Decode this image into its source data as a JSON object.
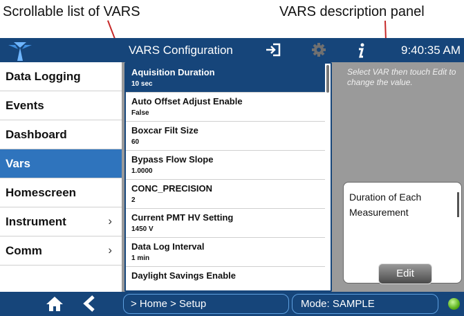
{
  "callouts": {
    "list": "Scrollable list of VARS",
    "description": "VARS description panel"
  },
  "header": {
    "title": "VARS Configuration",
    "time": "9:40:35 AM"
  },
  "sidebar": {
    "items": [
      {
        "label": "Data Logging",
        "chevron": false,
        "selected": false
      },
      {
        "label": "Events",
        "chevron": false,
        "selected": false
      },
      {
        "label": "Dashboard",
        "chevron": false,
        "selected": false
      },
      {
        "label": "Vars",
        "chevron": false,
        "selected": true
      },
      {
        "label": "Homescreen",
        "chevron": false,
        "selected": false
      },
      {
        "label": "Instrument",
        "chevron": true,
        "selected": false
      },
      {
        "label": "Comm",
        "chevron": true,
        "selected": false
      }
    ]
  },
  "vars": [
    {
      "name": "Aquisition Duration",
      "value": "10 sec",
      "selected": true
    },
    {
      "name": "Auto Offset Adjust Enable",
      "value": "False",
      "selected": false
    },
    {
      "name": "Boxcar Filt Size",
      "value": "60",
      "selected": false
    },
    {
      "name": "Bypass Flow Slope",
      "value": "1.0000",
      "selected": false
    },
    {
      "name": "CONC_PRECISION",
      "value": "2",
      "selected": false
    },
    {
      "name": "Current PMT HV Setting",
      "value": "1450 V",
      "selected": false
    },
    {
      "name": "Data Log Interval",
      "value": "1 min",
      "selected": false
    },
    {
      "name": "Daylight Savings Enable",
      "value": "",
      "selected": false
    }
  ],
  "hint": "Select VAR then touch Edit to change the value.",
  "description": {
    "text": "Duration of Each Measurement"
  },
  "edit_label": "Edit",
  "footer": {
    "breadcrumb": "> Home > Setup",
    "mode": "Mode: SAMPLE"
  },
  "colors": {
    "bar": "#16457a",
    "selected": "#2f74bd",
    "status_led": "#5cb21c"
  }
}
